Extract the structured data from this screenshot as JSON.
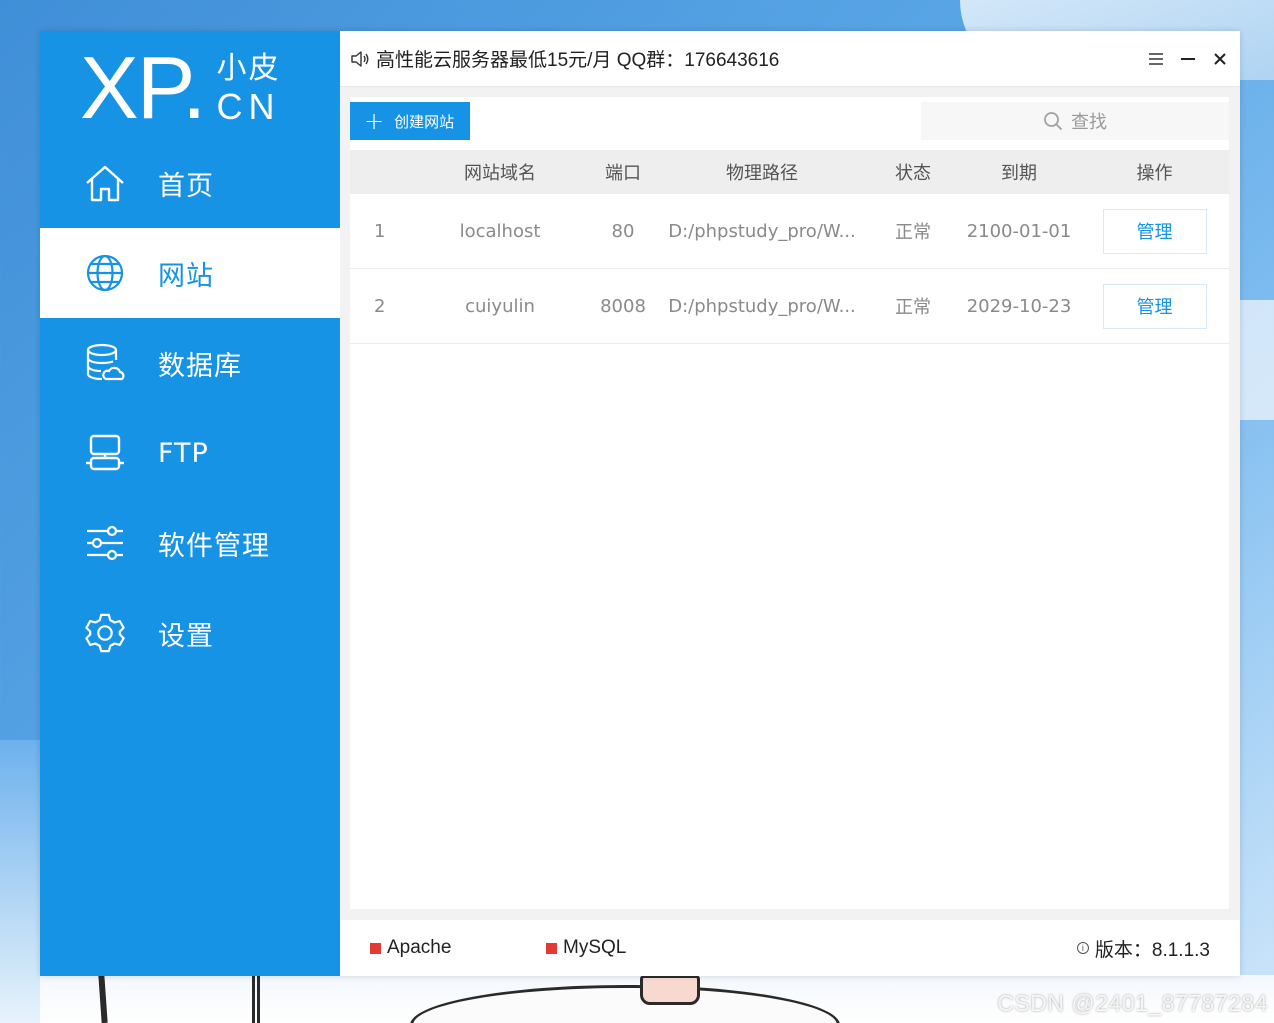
{
  "logo": {
    "brand": "XP.",
    "cn_top": "小皮",
    "cn_bottom": "CN"
  },
  "sidebar": {
    "items": [
      {
        "label": "首页",
        "icon": "home-icon",
        "active": false
      },
      {
        "label": "网站",
        "icon": "globe-icon",
        "active": true
      },
      {
        "label": "数据库",
        "icon": "database-icon",
        "active": false
      },
      {
        "label": "FTP",
        "icon": "server-icon",
        "active": false
      },
      {
        "label": "软件管理",
        "icon": "sliders-icon",
        "active": false
      },
      {
        "label": "设置",
        "icon": "gear-icon",
        "active": false
      }
    ]
  },
  "titlebar": {
    "notice": "高性能云服务器最低15元/月  QQ群：176643616",
    "controls": [
      "menu-icon",
      "minimize-icon",
      "close-icon"
    ]
  },
  "toolbar": {
    "create_label": "创建网站",
    "search_placeholder": "查找"
  },
  "table": {
    "headers": [
      "",
      "网站域名",
      "端口",
      "物理路径",
      "状态",
      "到期",
      "操作"
    ],
    "rows": [
      {
        "index": "1",
        "domain": "localhost",
        "port": "80",
        "path": "D:/phpstudy_pro/W...",
        "status": "正常",
        "expiry": "2100-01-01",
        "action": "管理"
      },
      {
        "index": "2",
        "domain": "cuiyulin",
        "port": "8008",
        "path": "D:/phpstudy_pro/W...",
        "status": "正常",
        "expiry": "2029-10-23",
        "action": "管理"
      }
    ]
  },
  "statusbar": {
    "services": [
      {
        "name": "Apache",
        "color": "#e53935"
      },
      {
        "name": "MySQL",
        "color": "#e53935"
      }
    ],
    "version": "版本：8.1.1.3"
  },
  "watermark": "CSDN @2401_87787284",
  "colors": {
    "accent": "#1793e6",
    "stopped": "#e53935"
  }
}
